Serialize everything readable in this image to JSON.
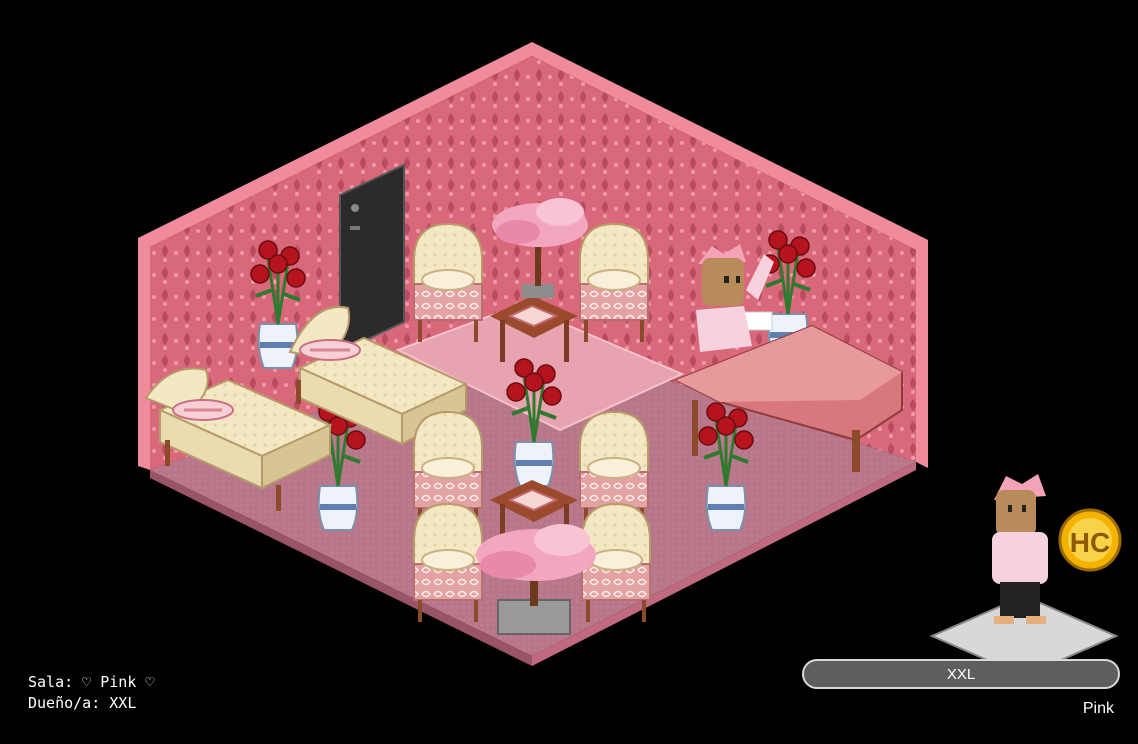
{
  "room": {
    "name_line": "Sala: ♡ Pink ♡",
    "owner_line": "Dueño/a: XXL"
  },
  "user_card": {
    "username": "XXL",
    "motto": "Pink",
    "badge_text": "HC"
  },
  "colors": {
    "background": "#000000",
    "wall": "#d9687a",
    "floor": "#b9788c",
    "rug": "#e7a2b0",
    "accent_pink": "#f3a6c0",
    "rose_red": "#b5141e",
    "hc_gold": "#f5b301"
  },
  "icons": [
    "door-icon",
    "rose-vase-icon",
    "cherry-tree-icon",
    "armchair-icon",
    "chaise-lounge-icon",
    "grand-piano-icon",
    "avatar-icon",
    "hc-badge-icon"
  ]
}
